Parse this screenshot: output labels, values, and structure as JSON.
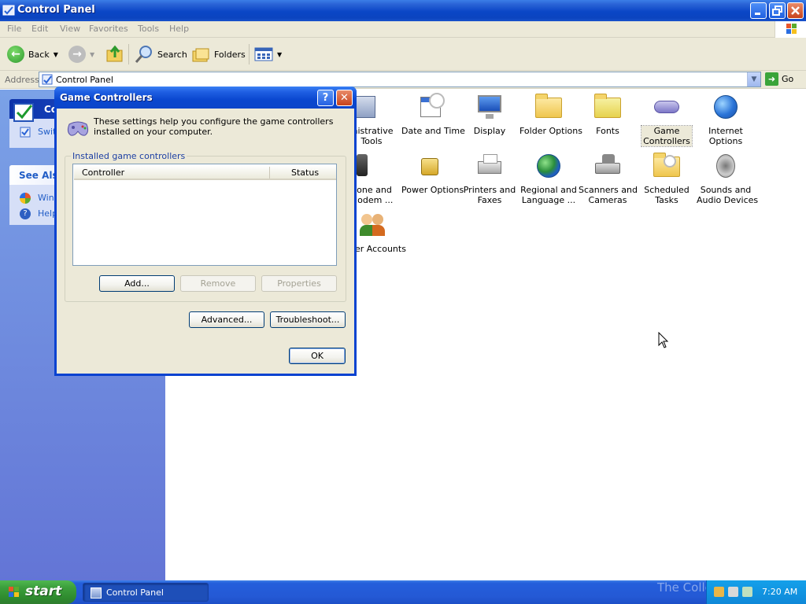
{
  "window": {
    "title": "Control Panel"
  },
  "menu": {
    "items": [
      "File",
      "Edit",
      "View",
      "Favorites",
      "Tools",
      "Help"
    ]
  },
  "toolbar": {
    "back_label": "Back",
    "search_label": "Search",
    "folders_label": "Folders"
  },
  "address": {
    "label": "Address",
    "value": "Control Panel",
    "go_label": "Go"
  },
  "taskpane": {
    "panel_title": "Cont",
    "switch_link": "Swit",
    "see_also_title": "See Also",
    "links": [
      "Wind",
      "Help"
    ]
  },
  "control_panel_icons": [
    {
      "label": "Administrative Tools",
      "display": "inistrative\nTools",
      "icon": "admin-tools-icon"
    },
    {
      "label": "Date and Time",
      "display": "Date and Time",
      "icon": "date-time-icon"
    },
    {
      "label": "Display",
      "display": "Display",
      "icon": "display-icon"
    },
    {
      "label": "Folder Options",
      "display": "Folder Options",
      "icon": "folder-options-icon"
    },
    {
      "label": "Fonts",
      "display": "Fonts",
      "icon": "fonts-folder-icon"
    },
    {
      "label": "Game Controllers",
      "display": "Game\nControllers",
      "icon": "game-controller-icon",
      "selected": true
    },
    {
      "label": "Internet Options",
      "display": "Internet\nOptions",
      "icon": "internet-options-icon"
    },
    {
      "label": "Phone and Modem Options",
      "display": "hone and\nModem ...",
      "icon": "phone-modem-icon"
    },
    {
      "label": "Power Options",
      "display": "Power Options",
      "icon": "power-options-icon"
    },
    {
      "label": "Printers and Faxes",
      "display": "Printers and\nFaxes",
      "icon": "printer-icon"
    },
    {
      "label": "Regional and Language Options",
      "display": "Regional and\nLanguage ...",
      "icon": "globe-icon"
    },
    {
      "label": "Scanners and Cameras",
      "display": "Scanners and\nCameras",
      "icon": "scanner-camera-icon"
    },
    {
      "label": "Scheduled Tasks",
      "display": "Scheduled\nTasks",
      "icon": "scheduled-tasks-icon"
    },
    {
      "label": "Sounds and Audio Devices",
      "display": "Sounds and\nAudio Devices",
      "icon": "speaker-icon"
    },
    {
      "label": "User Accounts",
      "display": "er Accounts",
      "icon": "user-accounts-icon"
    }
  ],
  "dialog": {
    "title": "Game Controllers",
    "help_glyph": "?",
    "close_glyph": "✕",
    "intro": "These settings help you configure the game controllers installed on your computer.",
    "group_label": "Installed game controllers",
    "columns": [
      "Controller",
      "Status"
    ],
    "rows": [],
    "buttons": {
      "add": "Add...",
      "remove": "Remove",
      "properties": "Properties",
      "advanced": "Advanced...",
      "troubleshoot": "Troubleshoot...",
      "ok": "OK"
    }
  },
  "taskbar": {
    "start_label": "start",
    "task_label": "Control Panel",
    "watermark": "The Collection Book",
    "clock": "7:20 AM"
  }
}
